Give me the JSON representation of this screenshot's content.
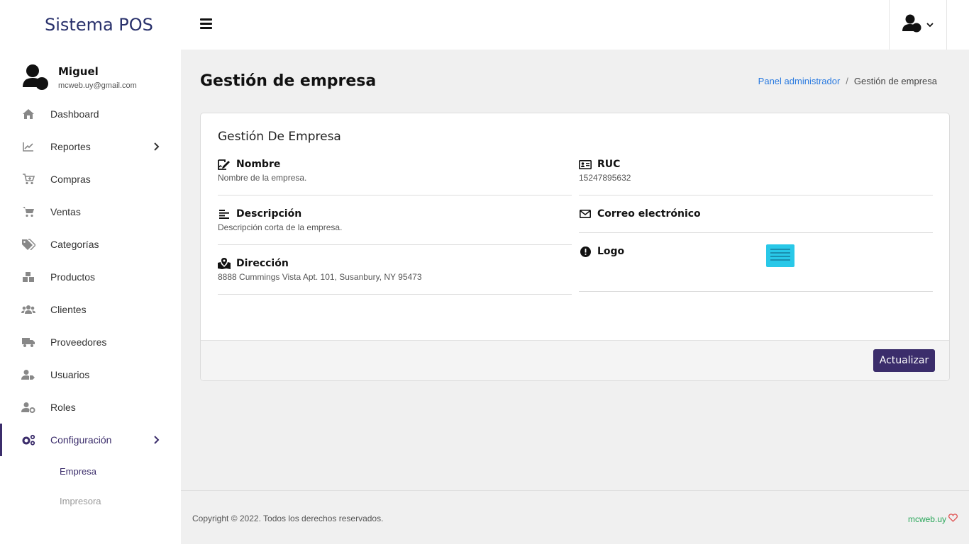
{
  "brand": "Sistema POS",
  "user": {
    "name": "Miguel",
    "email": "mcweb.uy@gmail.com"
  },
  "nav": {
    "items": [
      {
        "label": "Dashboard",
        "icon": "home-icon"
      },
      {
        "label": "Reportes",
        "icon": "chart-line-icon"
      },
      {
        "label": "Compras",
        "icon": "cart-plus-icon"
      },
      {
        "label": "Ventas",
        "icon": "cart-icon"
      },
      {
        "label": "Categorías",
        "icon": "tags-icon"
      },
      {
        "label": "Productos",
        "icon": "boxes-icon"
      },
      {
        "label": "Clientes",
        "icon": "users-icon"
      },
      {
        "label": "Proveedores",
        "icon": "truck-icon"
      },
      {
        "label": "Usuarios",
        "icon": "user-tag-icon"
      },
      {
        "label": "Roles",
        "icon": "user-cog-icon"
      },
      {
        "label": "Configuración",
        "icon": "cogs-icon"
      }
    ],
    "sub_items": [
      {
        "label": "Empresa"
      },
      {
        "label": "Impresora"
      }
    ]
  },
  "header": {
    "title": "Gestión de empresa"
  },
  "breadcrumb": {
    "parent": "Panel administrador",
    "separator": "/",
    "current": "Gestión de empresa"
  },
  "card": {
    "title": "Gestión De Empresa",
    "fields": {
      "nombre": {
        "label": "Nombre",
        "value": "Nombre de la empresa."
      },
      "descripcion": {
        "label": "Descripción",
        "value": "Descripción corta de la empresa."
      },
      "direccion": {
        "label": "Dirección",
        "value": "8888 Cummings Vista Apt. 101, Susanbury, NY 95473"
      },
      "ruc": {
        "label": "RUC",
        "value": "15247895632"
      },
      "correo": {
        "label": "Correo electrónico",
        "value": ""
      },
      "logo": {
        "label": "Logo"
      }
    },
    "update_label": "Actualizar"
  },
  "footer": {
    "copyright": "Copyright © 2022. Todos los derechos reservados.",
    "credit": "mcweb.uy"
  },
  "colors": {
    "primary": "#3b2d6b",
    "brand": "#28306b",
    "link": "#2b7be0",
    "credit": "#2aa65a",
    "heart": "#e05555",
    "logo": "#29c8e8"
  }
}
